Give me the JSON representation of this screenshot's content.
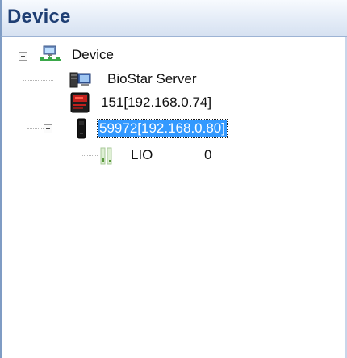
{
  "header": {
    "title": "Device"
  },
  "tree": {
    "root": {
      "label": "Device",
      "icon": "network-computers-icon",
      "expanded": true
    },
    "nodes": [
      {
        "label": "BioStar Server",
        "icon": "server-icon"
      },
      {
        "label": "151[192.168.0.74]",
        "icon": "reader-device-red-icon"
      },
      {
        "label": "59972[192.168.0.80]",
        "icon": "reader-device-black-icon",
        "expanded": true,
        "selected": true,
        "children": [
          {
            "label": "LIO",
            "value": "0",
            "icon": "io-module-icon"
          }
        ]
      }
    ]
  },
  "colors": {
    "header_text": "#1f3f74",
    "selection_bg": "#3399ff",
    "selection_text": "#ffffff",
    "tree_lines": "#b5b5b5"
  }
}
